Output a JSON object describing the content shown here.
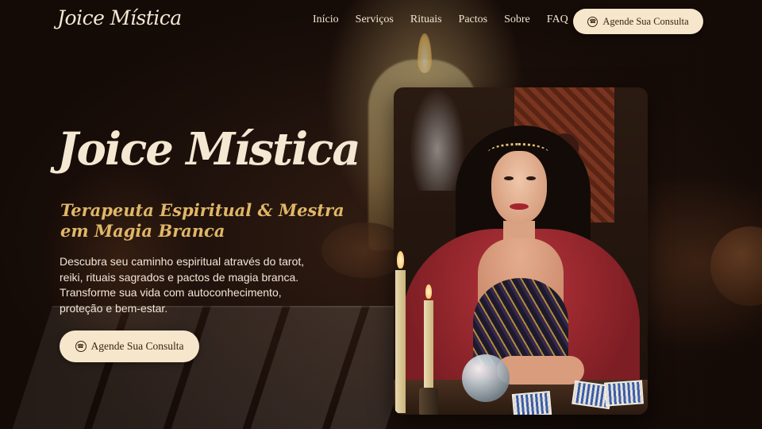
{
  "brand": {
    "logo": "Joice Mística"
  },
  "nav": {
    "items": [
      "Início",
      "Serviços",
      "Rituais",
      "Pactos",
      "Sobre",
      "FAQ"
    ]
  },
  "header": {
    "cta_label": "Agende Sua Consulta",
    "cta_icon": "whatsapp-icon"
  },
  "hero": {
    "title": "Joice Mística",
    "subtitle": "Terapeuta Espiritual & Mestra em Magia Branca",
    "description": "Descubra seu caminho espiritual através do tarot, reiki, rituais sagrados e pactos de magia branca. Transforme sua vida com autoconhecimento, proteção e bem-estar.",
    "cta_label": "Agende Sua Consulta",
    "cta_icon": "whatsapp-icon"
  },
  "colors": {
    "accent_gold": "#e0b768",
    "button_bg": "#f6e6cb",
    "text_light": "#f5e8d3",
    "background": "#1a0f0a"
  }
}
